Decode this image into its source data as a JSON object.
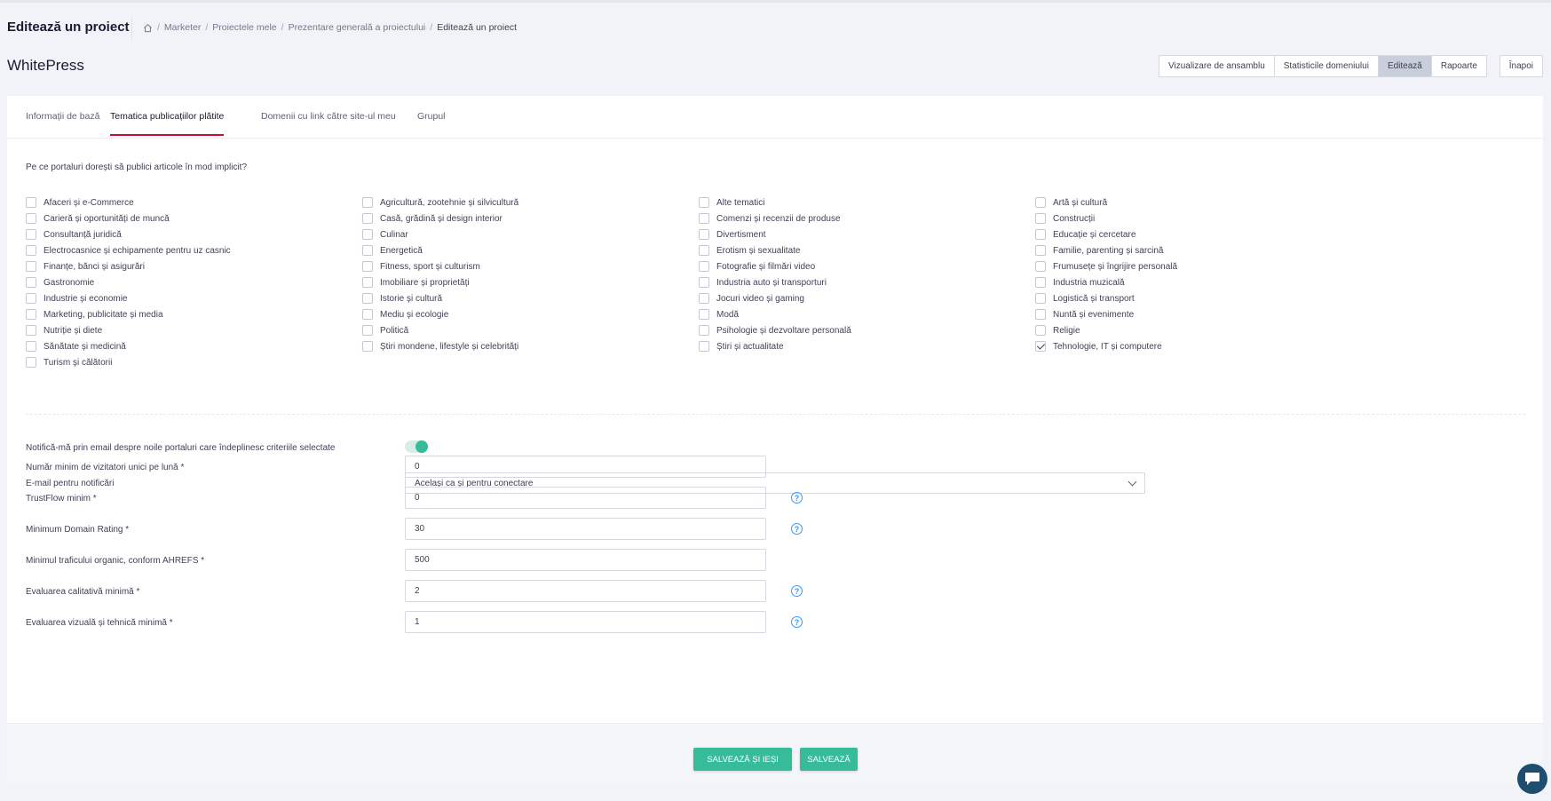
{
  "header": {
    "page_title": "Editează un proiect",
    "breadcrumb": [
      "Marketer",
      "Proiectele mele",
      "Prezentare generală a proiectului",
      "Editează un proiect"
    ]
  },
  "project": {
    "name": "WhitePress",
    "nav_buttons": [
      "Vizualizare de ansamblu",
      "Statisticile domeniului",
      "Editează",
      "Rapoarte"
    ],
    "active_nav": "Editează",
    "back_label": "Înapoi"
  },
  "tabs": [
    "Informații de bază",
    "Tematica publicațiilor plătite",
    "Domenii cu link către site-ul meu",
    "Grupul"
  ],
  "question": "Pe ce portaluri dorești să publici articole în mod implicit?",
  "categories": [
    {
      "label": "Afaceri și e-Commerce",
      "checked": false
    },
    {
      "label": "Agricultură, zootehnie și silvicultură",
      "checked": false
    },
    {
      "label": "Alte tematici",
      "checked": false
    },
    {
      "label": "Artă și cultură",
      "checked": false
    },
    {
      "label": "Carieră și oportunități de muncă",
      "checked": false
    },
    {
      "label": "Casă, grădină și design interior",
      "checked": false
    },
    {
      "label": "Comenzi și recenzii de produse",
      "checked": false
    },
    {
      "label": "Construcții",
      "checked": false
    },
    {
      "label": "Consultanță juridică",
      "checked": false
    },
    {
      "label": "Culinar",
      "checked": false
    },
    {
      "label": "Divertisment",
      "checked": false
    },
    {
      "label": "Educație și cercetare",
      "checked": false
    },
    {
      "label": "Electrocasnice și echipamente pentru uz casnic",
      "checked": false
    },
    {
      "label": "Energetică",
      "checked": false
    },
    {
      "label": "Erotism și sexualitate",
      "checked": false
    },
    {
      "label": "Familie, parenting și sarcină",
      "checked": false
    },
    {
      "label": "Finanțe, bănci și asigurări",
      "checked": false
    },
    {
      "label": "Fitness, sport și culturism",
      "checked": false
    },
    {
      "label": "Fotografie și filmări video",
      "checked": false
    },
    {
      "label": "Frumusețe și îngrijire personală",
      "checked": false
    },
    {
      "label": "Gastronomie",
      "checked": false
    },
    {
      "label": "Imobiliare și proprietăți",
      "checked": false
    },
    {
      "label": "Industria auto și transporturi",
      "checked": false
    },
    {
      "label": "Industria muzicală",
      "checked": false
    },
    {
      "label": "Industrie și economie",
      "checked": false
    },
    {
      "label": "Istorie și cultură",
      "checked": false
    },
    {
      "label": "Jocuri video și gaming",
      "checked": false
    },
    {
      "label": "Logistică și transport",
      "checked": false
    },
    {
      "label": "Marketing, publicitate și media",
      "checked": false
    },
    {
      "label": "Mediu și ecologie",
      "checked": false
    },
    {
      "label": "Modă",
      "checked": false
    },
    {
      "label": "Nuntă și evenimente",
      "checked": false
    },
    {
      "label": "Nutriție și diete",
      "checked": false
    },
    {
      "label": "Politică",
      "checked": false
    },
    {
      "label": "Psihologie și dezvoltare personală",
      "checked": false
    },
    {
      "label": "Religie",
      "checked": false
    },
    {
      "label": "Sănătate și medicină",
      "checked": false
    },
    {
      "label": "Știri mondene, lifestyle și celebrități",
      "checked": false
    },
    {
      "label": "Știri și actualitate",
      "checked": false
    },
    {
      "label": "Tehnologie, IT și computere",
      "checked": true
    },
    {
      "label": "Turism și călătorii",
      "checked": false
    }
  ],
  "form": {
    "notify_label": "Notifică-mă prin email despre noile portaluri care îndeplinesc criteriile selectate",
    "notify_enabled": true,
    "email_label": "E-mail pentru notificări",
    "email_value": "Același ca și pentru conectare",
    "fields": [
      {
        "label": "Număr minim de vizitatori unici pe lună *",
        "value": "0",
        "help": false
      },
      {
        "label": "TrustFlow minim *",
        "value": "0",
        "help": true
      },
      {
        "label": "Minimum Domain Rating *",
        "value": "30",
        "help": true
      },
      {
        "label": "Minimul traficului organic, conform AHREFS *",
        "value": "500",
        "help": false
      },
      {
        "label": "Evaluarea calitativă minimă *",
        "value": "2",
        "help": true
      },
      {
        "label": "Evaluarea vizuală și tehnică minimă *",
        "value": "1",
        "help": true
      }
    ]
  },
  "footer": {
    "save_exit_label": "SALVEAZĂ ȘI IEȘI",
    "save_label": "SALVEAZĂ"
  },
  "colors": {
    "accent": "#36bc9b",
    "tab_underline": "#c8102e",
    "help": "#3699ff"
  }
}
